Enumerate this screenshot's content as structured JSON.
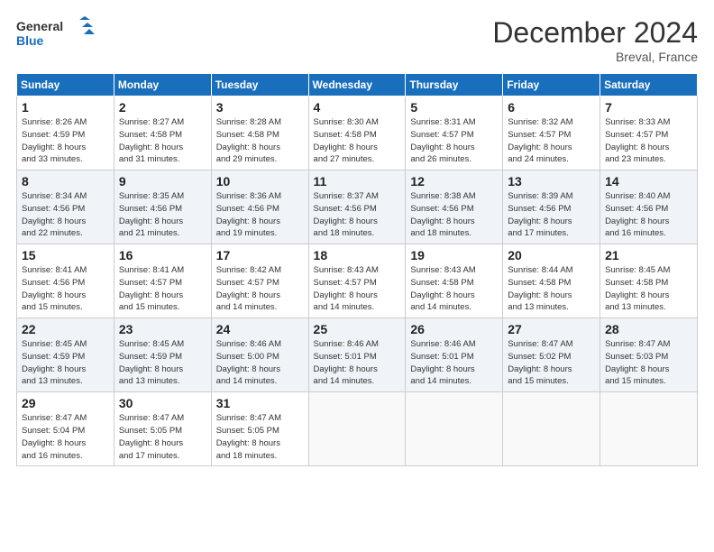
{
  "header": {
    "title": "December 2024",
    "subtitle": "Breval, France"
  },
  "days": [
    "Sunday",
    "Monday",
    "Tuesday",
    "Wednesday",
    "Thursday",
    "Friday",
    "Saturday"
  ],
  "weeks": [
    [
      {
        "num": "1",
        "info": "Sunrise: 8:26 AM\nSunset: 4:59 PM\nDaylight: 8 hours\nand 33 minutes."
      },
      {
        "num": "2",
        "info": "Sunrise: 8:27 AM\nSunset: 4:58 PM\nDaylight: 8 hours\nand 31 minutes."
      },
      {
        "num": "3",
        "info": "Sunrise: 8:28 AM\nSunset: 4:58 PM\nDaylight: 8 hours\nand 29 minutes."
      },
      {
        "num": "4",
        "info": "Sunrise: 8:30 AM\nSunset: 4:58 PM\nDaylight: 8 hours\nand 27 minutes."
      },
      {
        "num": "5",
        "info": "Sunrise: 8:31 AM\nSunset: 4:57 PM\nDaylight: 8 hours\nand 26 minutes."
      },
      {
        "num": "6",
        "info": "Sunrise: 8:32 AM\nSunset: 4:57 PM\nDaylight: 8 hours\nand 24 minutes."
      },
      {
        "num": "7",
        "info": "Sunrise: 8:33 AM\nSunset: 4:57 PM\nDaylight: 8 hours\nand 23 minutes."
      }
    ],
    [
      {
        "num": "8",
        "info": "Sunrise: 8:34 AM\nSunset: 4:56 PM\nDaylight: 8 hours\nand 22 minutes."
      },
      {
        "num": "9",
        "info": "Sunrise: 8:35 AM\nSunset: 4:56 PM\nDaylight: 8 hours\nand 21 minutes."
      },
      {
        "num": "10",
        "info": "Sunrise: 8:36 AM\nSunset: 4:56 PM\nDaylight: 8 hours\nand 19 minutes."
      },
      {
        "num": "11",
        "info": "Sunrise: 8:37 AM\nSunset: 4:56 PM\nDaylight: 8 hours\nand 18 minutes."
      },
      {
        "num": "12",
        "info": "Sunrise: 8:38 AM\nSunset: 4:56 PM\nDaylight: 8 hours\nand 18 minutes."
      },
      {
        "num": "13",
        "info": "Sunrise: 8:39 AM\nSunset: 4:56 PM\nDaylight: 8 hours\nand 17 minutes."
      },
      {
        "num": "14",
        "info": "Sunrise: 8:40 AM\nSunset: 4:56 PM\nDaylight: 8 hours\nand 16 minutes."
      }
    ],
    [
      {
        "num": "15",
        "info": "Sunrise: 8:41 AM\nSunset: 4:56 PM\nDaylight: 8 hours\nand 15 minutes."
      },
      {
        "num": "16",
        "info": "Sunrise: 8:41 AM\nSunset: 4:57 PM\nDaylight: 8 hours\nand 15 minutes."
      },
      {
        "num": "17",
        "info": "Sunrise: 8:42 AM\nSunset: 4:57 PM\nDaylight: 8 hours\nand 14 minutes."
      },
      {
        "num": "18",
        "info": "Sunrise: 8:43 AM\nSunset: 4:57 PM\nDaylight: 8 hours\nand 14 minutes."
      },
      {
        "num": "19",
        "info": "Sunrise: 8:43 AM\nSunset: 4:58 PM\nDaylight: 8 hours\nand 14 minutes."
      },
      {
        "num": "20",
        "info": "Sunrise: 8:44 AM\nSunset: 4:58 PM\nDaylight: 8 hours\nand 13 minutes."
      },
      {
        "num": "21",
        "info": "Sunrise: 8:45 AM\nSunset: 4:58 PM\nDaylight: 8 hours\nand 13 minutes."
      }
    ],
    [
      {
        "num": "22",
        "info": "Sunrise: 8:45 AM\nSunset: 4:59 PM\nDaylight: 8 hours\nand 13 minutes."
      },
      {
        "num": "23",
        "info": "Sunrise: 8:45 AM\nSunset: 4:59 PM\nDaylight: 8 hours\nand 13 minutes."
      },
      {
        "num": "24",
        "info": "Sunrise: 8:46 AM\nSunset: 5:00 PM\nDaylight: 8 hours\nand 14 minutes."
      },
      {
        "num": "25",
        "info": "Sunrise: 8:46 AM\nSunset: 5:01 PM\nDaylight: 8 hours\nand 14 minutes."
      },
      {
        "num": "26",
        "info": "Sunrise: 8:46 AM\nSunset: 5:01 PM\nDaylight: 8 hours\nand 14 minutes."
      },
      {
        "num": "27",
        "info": "Sunrise: 8:47 AM\nSunset: 5:02 PM\nDaylight: 8 hours\nand 15 minutes."
      },
      {
        "num": "28",
        "info": "Sunrise: 8:47 AM\nSunset: 5:03 PM\nDaylight: 8 hours\nand 15 minutes."
      }
    ],
    [
      {
        "num": "29",
        "info": "Sunrise: 8:47 AM\nSunset: 5:04 PM\nDaylight: 8 hours\nand 16 minutes."
      },
      {
        "num": "30",
        "info": "Sunrise: 8:47 AM\nSunset: 5:05 PM\nDaylight: 8 hours\nand 17 minutes."
      },
      {
        "num": "31",
        "info": "Sunrise: 8:47 AM\nSunset: 5:05 PM\nDaylight: 8 hours\nand 18 minutes."
      },
      null,
      null,
      null,
      null
    ]
  ]
}
